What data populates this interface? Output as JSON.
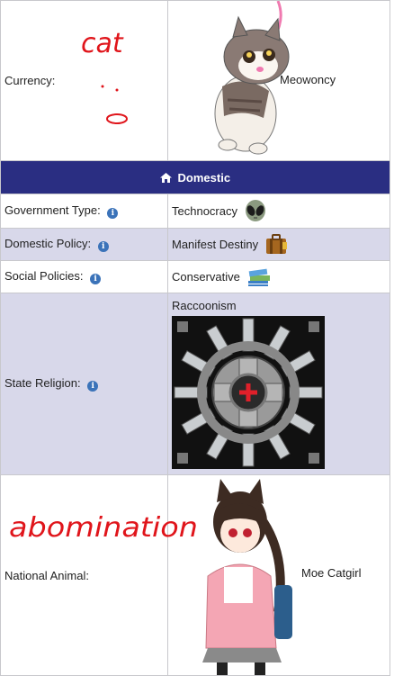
{
  "currency": {
    "label": "Currency:",
    "value": "Meowoncy",
    "scribble": "cat"
  },
  "domestic": {
    "header": "Domestic",
    "icon": "home-icon",
    "accent": "#2a2e82"
  },
  "rows": {
    "government": {
      "label": "Government Type:",
      "value": "Technocracy",
      "icon": "alien-icon"
    },
    "domestic_policy": {
      "label": "Domestic Policy:",
      "value": "Manifest Destiny",
      "icon": "suitcase-icon"
    },
    "social": {
      "label": "Social Policies:",
      "value": "Conservative",
      "icon": "books-icon"
    },
    "religion": {
      "label": "State Religion:",
      "value": "Raccoonism",
      "icon": "religion-emblem"
    },
    "animal": {
      "label": "National Animal:",
      "value": "Moe Catgirl",
      "scribble": "abomination"
    }
  },
  "colors": {
    "row_alt": "#d8d8ea",
    "info": "#3b73b9",
    "scribble": "#e0151b"
  }
}
